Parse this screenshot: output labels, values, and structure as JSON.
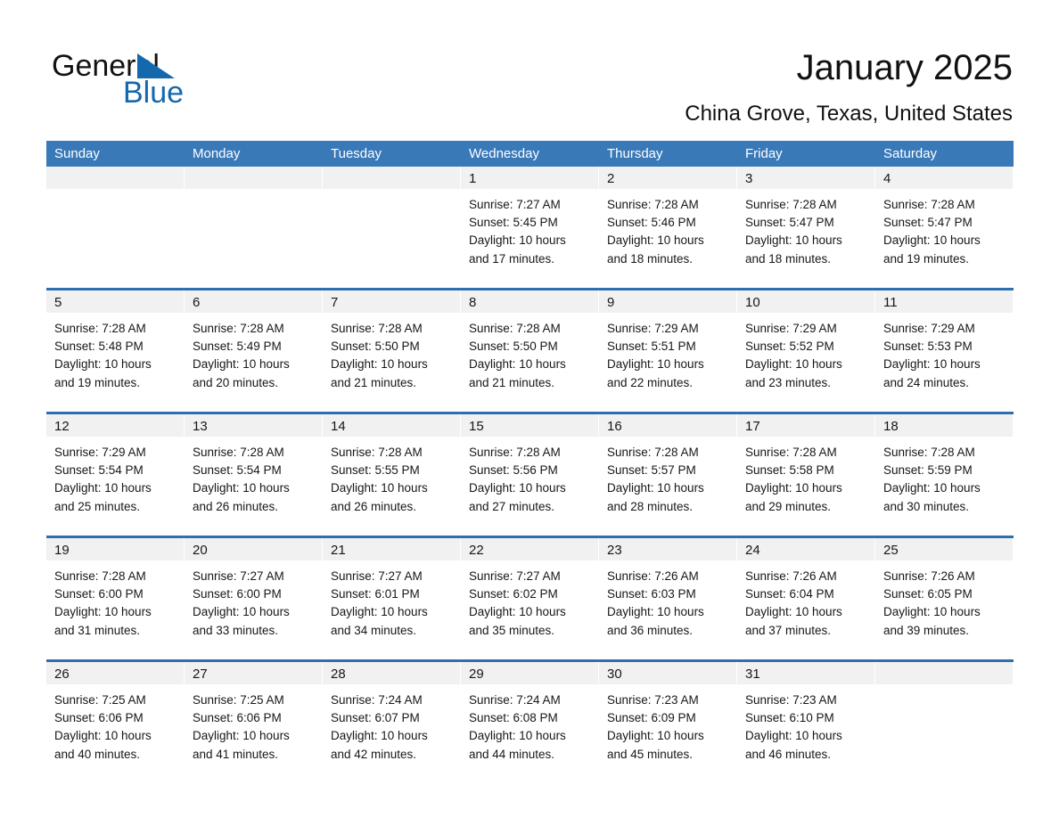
{
  "brand": {
    "word1": "General",
    "word2": "Blue",
    "accent_color": "#1468ad"
  },
  "header": {
    "title": "January 2025",
    "subtitle": "China Grove, Texas, United States"
  },
  "theme": {
    "header_blue": "#3a79b8",
    "separator_blue": "#2f6fae",
    "daynum_band": "#f1f1f1"
  },
  "calendar": {
    "weekday_headers": [
      "Sunday",
      "Monday",
      "Tuesday",
      "Wednesday",
      "Thursday",
      "Friday",
      "Saturday"
    ],
    "weeks": [
      [
        {
          "day": "",
          "lines": []
        },
        {
          "day": "",
          "lines": []
        },
        {
          "day": "",
          "lines": []
        },
        {
          "day": "1",
          "lines": [
            "Sunrise: 7:27 AM",
            "Sunset: 5:45 PM",
            "Daylight: 10 hours",
            "and 17 minutes."
          ]
        },
        {
          "day": "2",
          "lines": [
            "Sunrise: 7:28 AM",
            "Sunset: 5:46 PM",
            "Daylight: 10 hours",
            "and 18 minutes."
          ]
        },
        {
          "day": "3",
          "lines": [
            "Sunrise: 7:28 AM",
            "Sunset: 5:47 PM",
            "Daylight: 10 hours",
            "and 18 minutes."
          ]
        },
        {
          "day": "4",
          "lines": [
            "Sunrise: 7:28 AM",
            "Sunset: 5:47 PM",
            "Daylight: 10 hours",
            "and 19 minutes."
          ]
        }
      ],
      [
        {
          "day": "5",
          "lines": [
            "Sunrise: 7:28 AM",
            "Sunset: 5:48 PM",
            "Daylight: 10 hours",
            "and 19 minutes."
          ]
        },
        {
          "day": "6",
          "lines": [
            "Sunrise: 7:28 AM",
            "Sunset: 5:49 PM",
            "Daylight: 10 hours",
            "and 20 minutes."
          ]
        },
        {
          "day": "7",
          "lines": [
            "Sunrise: 7:28 AM",
            "Sunset: 5:50 PM",
            "Daylight: 10 hours",
            "and 21 minutes."
          ]
        },
        {
          "day": "8",
          "lines": [
            "Sunrise: 7:28 AM",
            "Sunset: 5:50 PM",
            "Daylight: 10 hours",
            "and 21 minutes."
          ]
        },
        {
          "day": "9",
          "lines": [
            "Sunrise: 7:29 AM",
            "Sunset: 5:51 PM",
            "Daylight: 10 hours",
            "and 22 minutes."
          ]
        },
        {
          "day": "10",
          "lines": [
            "Sunrise: 7:29 AM",
            "Sunset: 5:52 PM",
            "Daylight: 10 hours",
            "and 23 minutes."
          ]
        },
        {
          "day": "11",
          "lines": [
            "Sunrise: 7:29 AM",
            "Sunset: 5:53 PM",
            "Daylight: 10 hours",
            "and 24 minutes."
          ]
        }
      ],
      [
        {
          "day": "12",
          "lines": [
            "Sunrise: 7:29 AM",
            "Sunset: 5:54 PM",
            "Daylight: 10 hours",
            "and 25 minutes."
          ]
        },
        {
          "day": "13",
          "lines": [
            "Sunrise: 7:28 AM",
            "Sunset: 5:54 PM",
            "Daylight: 10 hours",
            "and 26 minutes."
          ]
        },
        {
          "day": "14",
          "lines": [
            "Sunrise: 7:28 AM",
            "Sunset: 5:55 PM",
            "Daylight: 10 hours",
            "and 26 minutes."
          ]
        },
        {
          "day": "15",
          "lines": [
            "Sunrise: 7:28 AM",
            "Sunset: 5:56 PM",
            "Daylight: 10 hours",
            "and 27 minutes."
          ]
        },
        {
          "day": "16",
          "lines": [
            "Sunrise: 7:28 AM",
            "Sunset: 5:57 PM",
            "Daylight: 10 hours",
            "and 28 minutes."
          ]
        },
        {
          "day": "17",
          "lines": [
            "Sunrise: 7:28 AM",
            "Sunset: 5:58 PM",
            "Daylight: 10 hours",
            "and 29 minutes."
          ]
        },
        {
          "day": "18",
          "lines": [
            "Sunrise: 7:28 AM",
            "Sunset: 5:59 PM",
            "Daylight: 10 hours",
            "and 30 minutes."
          ]
        }
      ],
      [
        {
          "day": "19",
          "lines": [
            "Sunrise: 7:28 AM",
            "Sunset: 6:00 PM",
            "Daylight: 10 hours",
            "and 31 minutes."
          ]
        },
        {
          "day": "20",
          "lines": [
            "Sunrise: 7:27 AM",
            "Sunset: 6:00 PM",
            "Daylight: 10 hours",
            "and 33 minutes."
          ]
        },
        {
          "day": "21",
          "lines": [
            "Sunrise: 7:27 AM",
            "Sunset: 6:01 PM",
            "Daylight: 10 hours",
            "and 34 minutes."
          ]
        },
        {
          "day": "22",
          "lines": [
            "Sunrise: 7:27 AM",
            "Sunset: 6:02 PM",
            "Daylight: 10 hours",
            "and 35 minutes."
          ]
        },
        {
          "day": "23",
          "lines": [
            "Sunrise: 7:26 AM",
            "Sunset: 6:03 PM",
            "Daylight: 10 hours",
            "and 36 minutes."
          ]
        },
        {
          "day": "24",
          "lines": [
            "Sunrise: 7:26 AM",
            "Sunset: 6:04 PM",
            "Daylight: 10 hours",
            "and 37 minutes."
          ]
        },
        {
          "day": "25",
          "lines": [
            "Sunrise: 7:26 AM",
            "Sunset: 6:05 PM",
            "Daylight: 10 hours",
            "and 39 minutes."
          ]
        }
      ],
      [
        {
          "day": "26",
          "lines": [
            "Sunrise: 7:25 AM",
            "Sunset: 6:06 PM",
            "Daylight: 10 hours",
            "and 40 minutes."
          ]
        },
        {
          "day": "27",
          "lines": [
            "Sunrise: 7:25 AM",
            "Sunset: 6:06 PM",
            "Daylight: 10 hours",
            "and 41 minutes."
          ]
        },
        {
          "day": "28",
          "lines": [
            "Sunrise: 7:24 AM",
            "Sunset: 6:07 PM",
            "Daylight: 10 hours",
            "and 42 minutes."
          ]
        },
        {
          "day": "29",
          "lines": [
            "Sunrise: 7:24 AM",
            "Sunset: 6:08 PM",
            "Daylight: 10 hours",
            "and 44 minutes."
          ]
        },
        {
          "day": "30",
          "lines": [
            "Sunrise: 7:23 AM",
            "Sunset: 6:09 PM",
            "Daylight: 10 hours",
            "and 45 minutes."
          ]
        },
        {
          "day": "31",
          "lines": [
            "Sunrise: 7:23 AM",
            "Sunset: 6:10 PM",
            "Daylight: 10 hours",
            "and 46 minutes."
          ]
        },
        {
          "day": "",
          "lines": []
        }
      ]
    ]
  }
}
